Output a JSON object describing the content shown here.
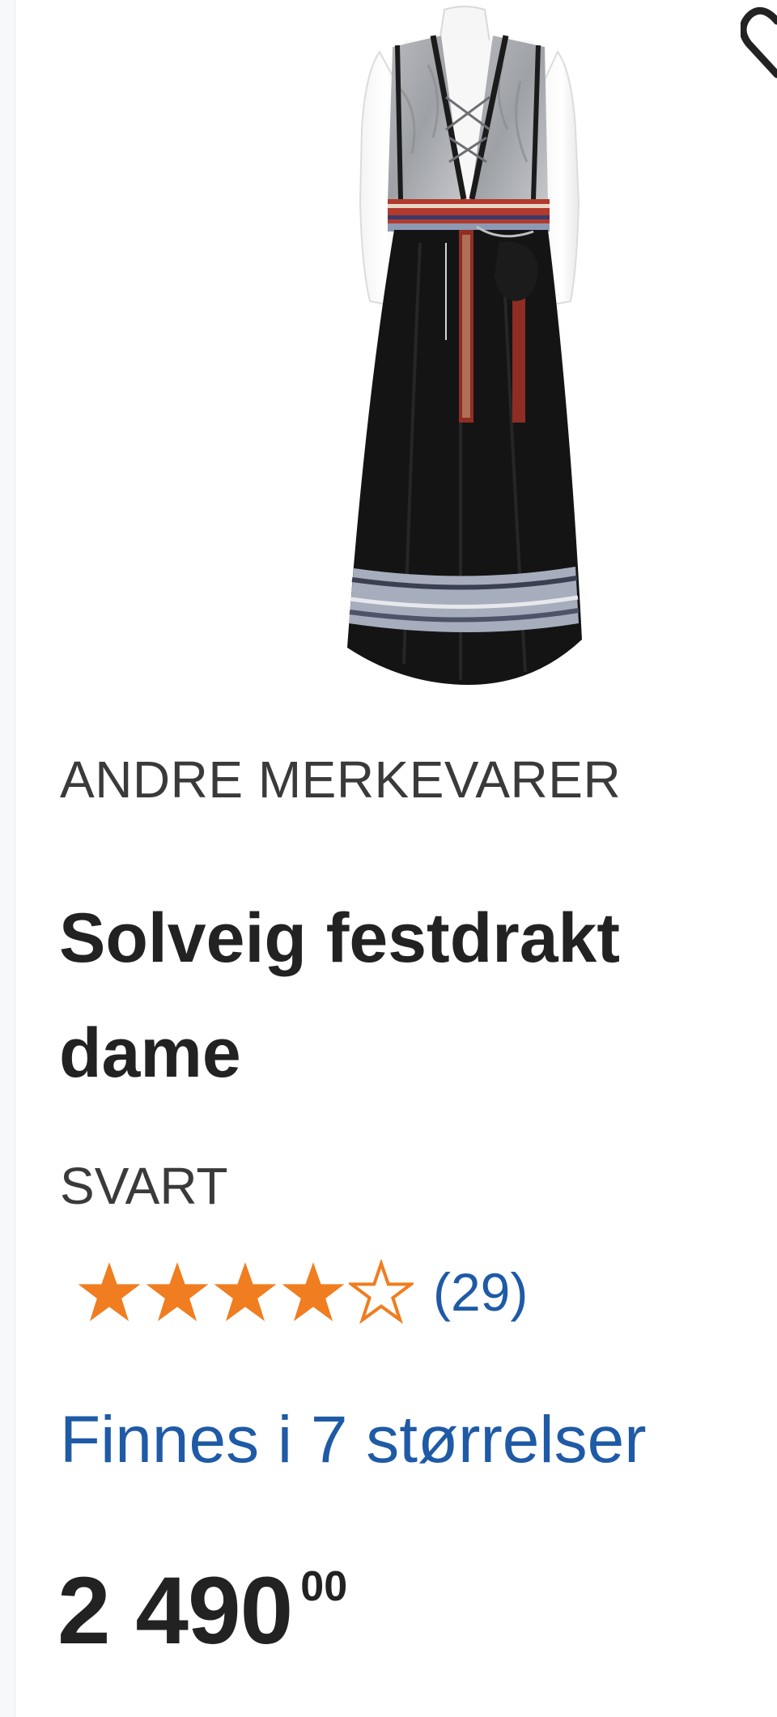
{
  "product": {
    "brand": "ANDRE MERKEVARER",
    "title_line1": "Solveig festdrakt",
    "title_line2": "dame",
    "color": "SVART",
    "rating": {
      "value": 4,
      "max": 5,
      "count_label": "(29)"
    },
    "sizes_link": "Finnes i 7 størrelser",
    "price": {
      "main": "2 490",
      "cents": "00"
    },
    "image_icon": "product-image",
    "wishlist_icon": "heart-icon"
  },
  "colors": {
    "star_filled": "#f07d1f",
    "link": "#1f5aa6",
    "text": "#222222"
  }
}
